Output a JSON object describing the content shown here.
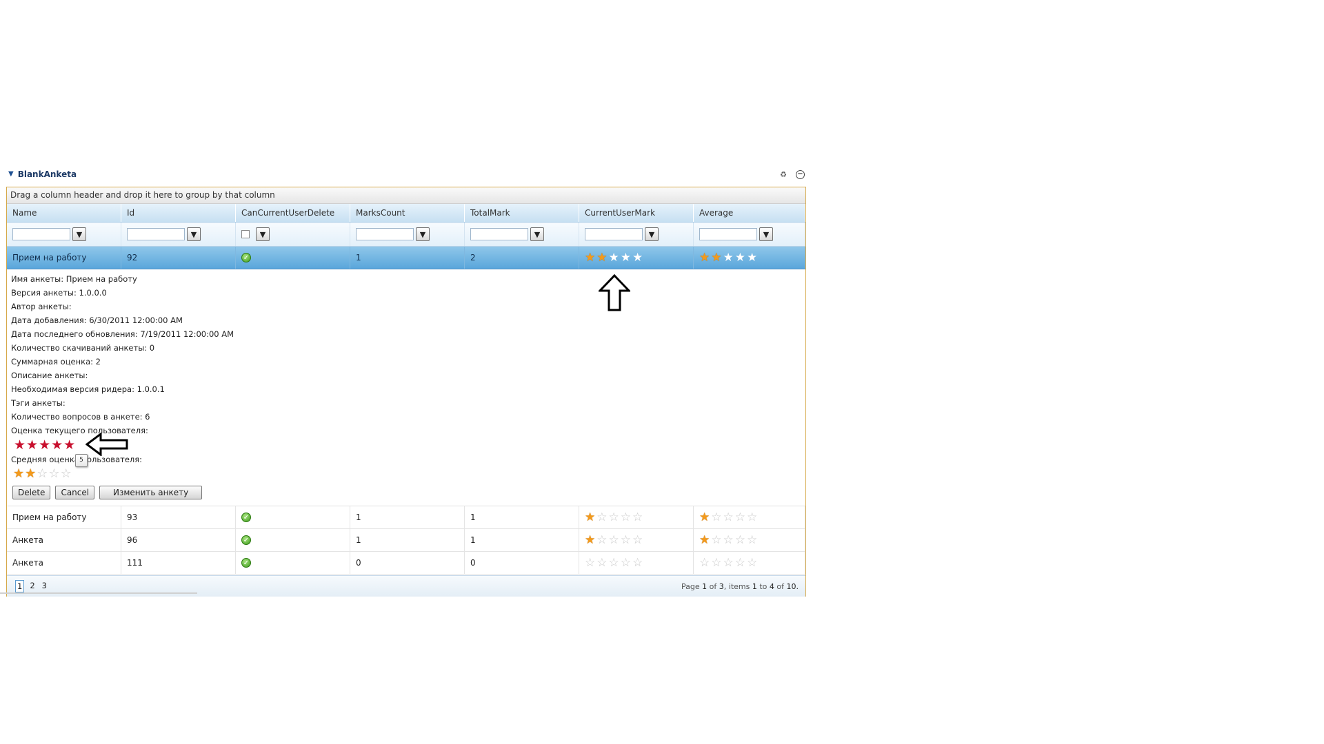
{
  "widget": {
    "title": "BlankAnketa",
    "icons": [
      "refresh-icon",
      "collapse-icon"
    ]
  },
  "grid": {
    "group_panel_text": "Drag a column header and drop it here to group by that column",
    "columns": [
      "Name",
      "Id",
      "CanCurrentUserDelete",
      "MarksCount",
      "TotalMark",
      "CurrentUserMark",
      "Average"
    ],
    "rows": [
      {
        "name": "Прием на работу",
        "id": "92",
        "can_delete": true,
        "marks_count": "1",
        "total_mark": "2",
        "current_user_mark": 2,
        "average": 2,
        "selected": true
      },
      {
        "name": "Прием на работу",
        "id": "93",
        "can_delete": true,
        "marks_count": "1",
        "total_mark": "1",
        "current_user_mark": 1,
        "average": 1,
        "selected": false
      },
      {
        "name": "Анкета",
        "id": "96",
        "can_delete": true,
        "marks_count": "1",
        "total_mark": "1",
        "current_user_mark": 1,
        "average": 1,
        "selected": false
      },
      {
        "name": "Анкета",
        "id": "111",
        "can_delete": true,
        "marks_count": "0",
        "total_mark": "0",
        "current_user_mark": 0,
        "average": 0,
        "selected": false
      }
    ],
    "max_stars": 5
  },
  "detail": {
    "lines": [
      "Имя анкеты: Прием на работу",
      "Версия анкеты: 1.0.0.0",
      "Автор анкеты:",
      "Дата добавления: 6/30/2011 12:00:00 AM",
      "Дата последнего обновления: 7/19/2011 12:00:00 AM",
      "Количество скачиваний анкеты: 0",
      "Суммарная оценка: 2",
      "Описание анкеты:",
      "Необходимая версия ридера: 1.0.0.1",
      "Тэги анкеты:",
      "Количество вопросов в анкете: 6"
    ],
    "user_rating_label": "Оценка текущего пользователя:",
    "user_rating_hover": 5,
    "avg_rating_label": "Средняя оценка пользователя:",
    "avg_rating": 2,
    "tooltip": "5",
    "buttons": {
      "delete": "Delete",
      "cancel": "Cancel",
      "edit": "Изменить анкету"
    }
  },
  "pager": {
    "pages": [
      "1",
      "2",
      "3"
    ],
    "current_page": "1",
    "info_prefix": "Page",
    "info_page": "1",
    "info_of": "of",
    "info_total_pages": "3",
    "info_items": ", items",
    "info_from": "1",
    "info_to_word": "to",
    "info_to": "4",
    "info_of2": "of",
    "info_total": "10."
  },
  "colors": {
    "header_blue": "#c7e0f2",
    "selected_row": "#5aa6db",
    "star_on": "#f39a1c",
    "star_off": "#c9c9c9",
    "star_hover": "#c8102e",
    "border_gold": "#d6a94a"
  }
}
